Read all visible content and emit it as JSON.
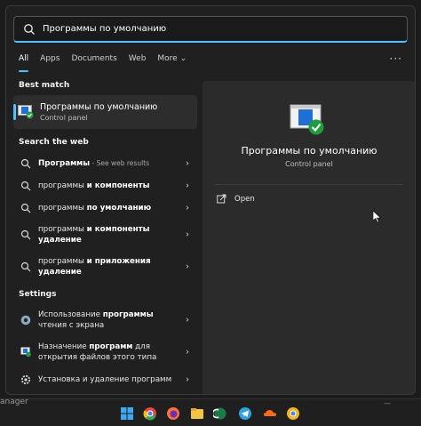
{
  "search": {
    "value": "Программы по умолчанию"
  },
  "filters": {
    "all": "All",
    "apps": "Apps",
    "documents": "Documents",
    "web": "Web",
    "more": "More",
    "more_chevron": "⌄",
    "overflow": "···"
  },
  "best_match": {
    "section": "Best match",
    "name": "Программы по умолчанию",
    "sub": "Control panel"
  },
  "web": {
    "section": "Search the web",
    "items": [
      {
        "bold": "Программы",
        "rest": "",
        "hint": " - See web results"
      },
      {
        "bold": "",
        "rest": "программы ",
        "bold2": "и компоненты"
      },
      {
        "bold": "",
        "rest": "программы ",
        "bold2": "по умолчанию"
      },
      {
        "rest": "программы ",
        "bold2": "и компоненты удаление"
      },
      {
        "rest": "программы ",
        "bold2": "и приложения удаление"
      }
    ]
  },
  "settings": {
    "section": "Settings",
    "items": [
      {
        "pre": "Использование ",
        "bold": "программы",
        "post": " чтения с экрана"
      },
      {
        "pre": "Назначение ",
        "bold": "программ",
        "post": " для открытия файлов этого типа"
      },
      {
        "pre": "Установка и удаление программ",
        "bold": "",
        "post": ""
      }
    ]
  },
  "detail": {
    "title": "Программы по умолчанию",
    "subtitle": "Control panel",
    "open_label": "Open"
  },
  "taskbar": {
    "left_text": "anager",
    "right_text": "—"
  },
  "colors": {
    "accent": "#4cc2ff",
    "panel": "#202020",
    "preview": "#2b2b2b"
  }
}
